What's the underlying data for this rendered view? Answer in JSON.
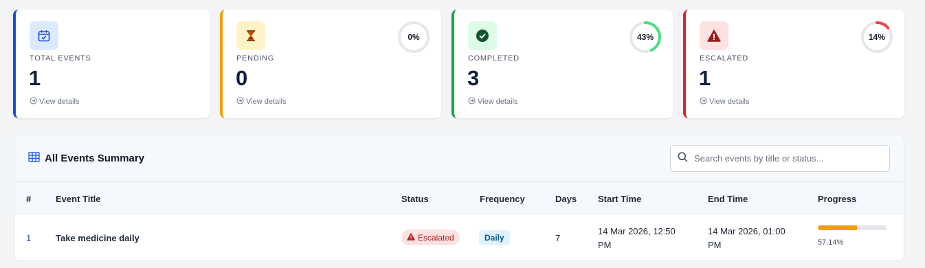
{
  "cards": [
    {
      "label": "TOTAL EVENTS",
      "value": "1",
      "details": "View details",
      "accent": "#1d4ed8",
      "icon": "calendar-check-icon"
    },
    {
      "label": "PENDING",
      "value": "0",
      "details": "View details",
      "accent": "#f59e0b",
      "icon": "hourglass-icon",
      "percent_text": "0%",
      "percent": 0
    },
    {
      "label": "COMPLETED",
      "value": "3",
      "details": "View details",
      "accent": "#16a34a",
      "icon": "check-circle-icon",
      "percent_text": "43%",
      "percent": 43
    },
    {
      "label": "ESCALATED",
      "value": "1",
      "details": "View details",
      "accent": "#dc2626",
      "icon": "warning-icon",
      "percent_text": "14%",
      "percent": 14
    }
  ],
  "summary": {
    "title": "All Events Summary",
    "search_placeholder": "Search events by title or status..."
  },
  "table": {
    "columns": [
      "#",
      "Event Title",
      "Status",
      "Frequency",
      "Days",
      "Start Time",
      "End Time",
      "Progress"
    ],
    "rows": [
      {
        "index": "1",
        "title": "Take medicine daily",
        "status": "Escalated",
        "frequency": "Daily",
        "days": "7",
        "start_line1": "14 Mar 2026, 12:50",
        "start_line2": "PM",
        "end_line1": "14 Mar 2026, 01:00",
        "end_line2": "PM",
        "progress_text": "57.14%",
        "progress": 57.14
      }
    ]
  }
}
